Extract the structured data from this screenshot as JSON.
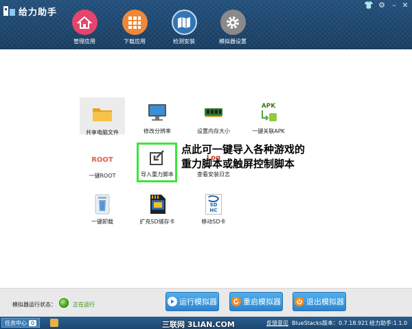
{
  "window": {
    "title": "给力助手",
    "controls": {
      "skin": "👕",
      "settings": "⚙",
      "minimize": "–",
      "close": "✕"
    }
  },
  "nav": [
    {
      "label": "管理应用",
      "icon": "home-icon",
      "color": "#e5456c"
    },
    {
      "label": "下载应用",
      "icon": "grid-icon",
      "color": "#f0883a"
    },
    {
      "label": "检测安装",
      "icon": "map-icon",
      "color": "#3476b5"
    },
    {
      "label": "模拟器设置",
      "icon": "gear-icon",
      "color": "#8a8a8a"
    }
  ],
  "tiles": [
    {
      "label": "共享电脑文件",
      "icon": "folder-icon"
    },
    {
      "label": "修改分辨率",
      "icon": "monitor-icon"
    },
    {
      "label": "设置内存大小",
      "icon": "memory-icon"
    },
    {
      "label": "一键关联APK",
      "icon": "apk-icon",
      "icon_text": "APK"
    },
    {
      "label": "一键ROOT",
      "icon": "root-icon",
      "icon_text": "ROOT"
    },
    {
      "label": "导入重力脚本",
      "icon": "import-icon"
    },
    {
      "label": "查看安装日志",
      "icon": "log-icon",
      "icon_text": "Log"
    },
    {
      "label": "一键卸载",
      "icon": "trash-icon"
    },
    {
      "label": "扩充SD储存卡",
      "icon": "sd-card-icon"
    },
    {
      "label": "移动SD卡",
      "icon": "sdhc-icon",
      "icon_text": "SD HC"
    }
  ],
  "callout": {
    "line1": "点此可一键导入各种游戏的",
    "line2": "重力脚本或触屏控制脚本"
  },
  "status": {
    "label": "模拟器运行状态：",
    "value": "正在运行"
  },
  "buttons": {
    "run": "运行模拟器",
    "restart": "重启模拟器",
    "exit": "退出模拟器"
  },
  "taskbar": {
    "task_center": "任务中心",
    "task_count": "0",
    "watermark": "三联网 3LIAN.COM",
    "feedback": "反馈意见",
    "bluestacks_version": "BlueStacks版本：0.7.18.921",
    "app_version": "给力助手:1.1.0"
  },
  "colors": {
    "header": "#1c4670",
    "accent_green": "#39e639",
    "button_blue": "#2d84cf"
  }
}
